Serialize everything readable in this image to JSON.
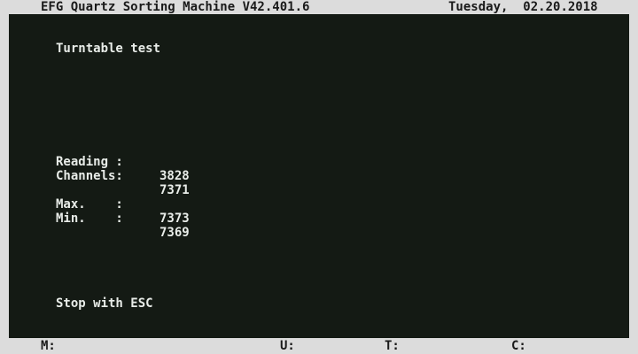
{
  "header": {
    "title": "EFG Quartz Sorting Machine V42.401.6",
    "day": "Tuesday,",
    "date": "02.20.2018"
  },
  "screen": {
    "test_title": "Turntable test",
    "readings": [
      {
        "label": "Reading :",
        "value": "3828"
      },
      {
        "label": "Channels:",
        "value": "7371"
      }
    ],
    "limits": [
      {
        "label": "Max.    :",
        "value": "7373"
      },
      {
        "label": "Min.    :",
        "value": "7369"
      }
    ],
    "hint": "Stop with ESC"
  },
  "status_bar": {
    "m_label": "M:",
    "u_label": "U:",
    "t_label": "T:",
    "c_label": "C:"
  }
}
